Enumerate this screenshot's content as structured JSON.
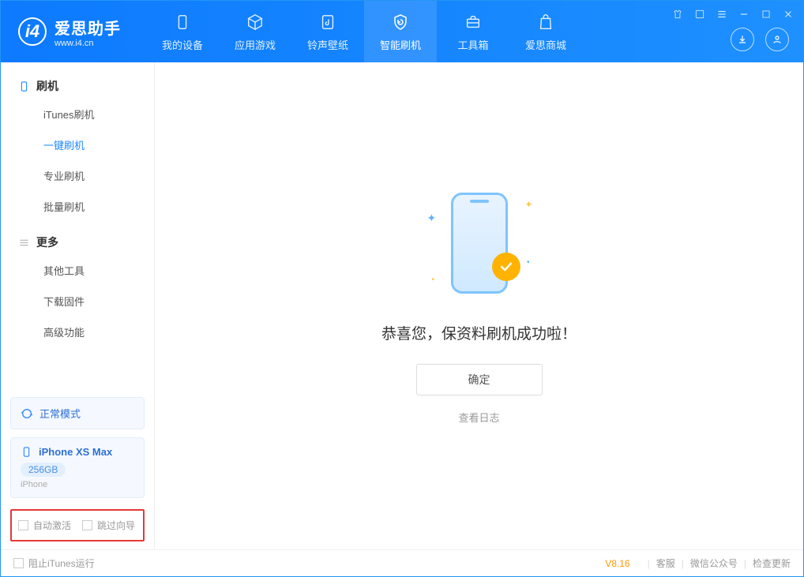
{
  "app": {
    "name": "爱思助手",
    "domain": "www.i4.cn"
  },
  "nav": {
    "items": [
      {
        "label": "我的设备"
      },
      {
        "label": "应用游戏"
      },
      {
        "label": "铃声壁纸"
      },
      {
        "label": "智能刷机"
      },
      {
        "label": "工具箱"
      },
      {
        "label": "爱思商城"
      }
    ]
  },
  "sidebar": {
    "group_flash": "刷机",
    "items_flash": [
      {
        "label": "iTunes刷机"
      },
      {
        "label": "一键刷机"
      },
      {
        "label": "专业刷机"
      },
      {
        "label": "批量刷机"
      }
    ],
    "group_more": "更多",
    "items_more": [
      {
        "label": "其他工具"
      },
      {
        "label": "下载固件"
      },
      {
        "label": "高级功能"
      }
    ],
    "mode": "正常模式",
    "device": {
      "name": "iPhone XS Max",
      "storage": "256GB",
      "type": "iPhone"
    },
    "checkbox1": "自动激活",
    "checkbox2": "跳过向导"
  },
  "main": {
    "message": "恭喜您，保资料刷机成功啦！",
    "ok_button": "确定",
    "view_log": "查看日志"
  },
  "statusbar": {
    "block_itunes": "阻止iTunes运行",
    "version": "V8.16",
    "link1": "客服",
    "link2": "微信公众号",
    "link3": "检查更新"
  }
}
